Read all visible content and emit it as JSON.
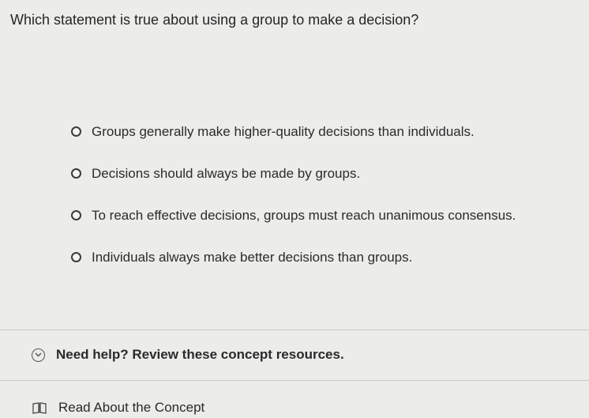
{
  "question": {
    "text": "Which statement is true about using a group to make a decision?"
  },
  "options": [
    {
      "label": "Groups generally make higher-quality decisions than individuals."
    },
    {
      "label": "Decisions should always be made by groups."
    },
    {
      "label": "To reach effective decisions, groups must reach unanimous consensus."
    },
    {
      "label": "Individuals always make better decisions than groups."
    }
  ],
  "help": {
    "label": "Need help? Review these concept resources.",
    "icon": "chevron-down-circle-icon"
  },
  "resource": {
    "label": "Read About the Concept",
    "icon": "book-icon"
  }
}
